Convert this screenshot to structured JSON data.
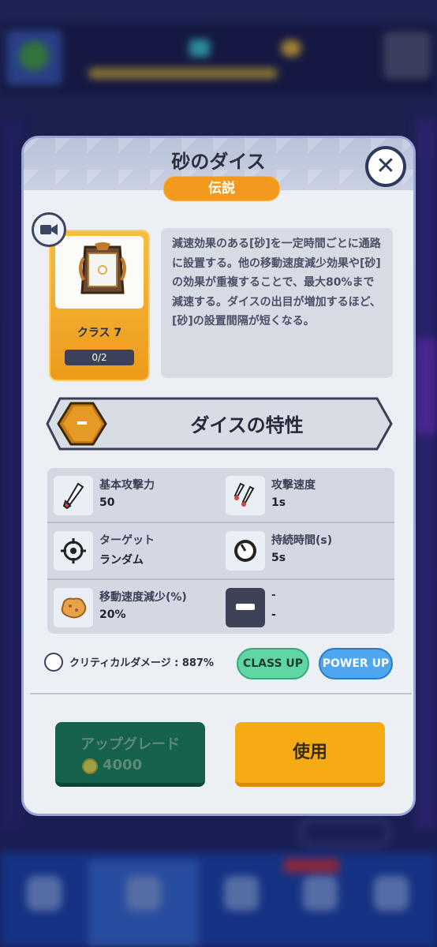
{
  "dialog": {
    "title": "砂のダイス",
    "rarity": "伝説",
    "dice_class": "クラス 7",
    "card_count": "0/2",
    "description": "減速効果のある[砂]を一定時間ごとに通路に設置する。他の移動速度減少効果や[砂]の効果が重複することで、最大80%まで減速する。ダイスの出目が増加するほど、[砂]の設置間隔が短くなる。",
    "traits_title": "ダイスの特性",
    "stats": [
      {
        "label": "基本攻撃力",
        "value": "50",
        "icon": "sword-icon"
      },
      {
        "label": "攻撃速度",
        "value": "1s",
        "icon": "attack-speed-icon"
      },
      {
        "label": "ターゲット",
        "value": "ランダム",
        "icon": "target-icon"
      },
      {
        "label": "持続時間(s)",
        "value": "5s",
        "icon": "timer-icon"
      },
      {
        "label": "移動速度減少(%)",
        "value": "20%",
        "icon": "sand-icon"
      },
      {
        "label": "-",
        "value": "-",
        "icon": "dash-icon"
      }
    ],
    "critical_label": "クリティカルダメージ : ",
    "critical_value": "887%",
    "class_up_label": "CLASS UP",
    "power_up_label": "POWER UP",
    "upgrade_label": "アップグレード",
    "upgrade_cost": "4000",
    "use_label": "使用"
  },
  "colors": {
    "rarity_orange": "#f39a1e",
    "class_up_green": "#5fd6a4",
    "power_up_blue": "#4ea6ee",
    "upgrade_green": "#16614b",
    "use_yellow": "#f5ac14"
  }
}
